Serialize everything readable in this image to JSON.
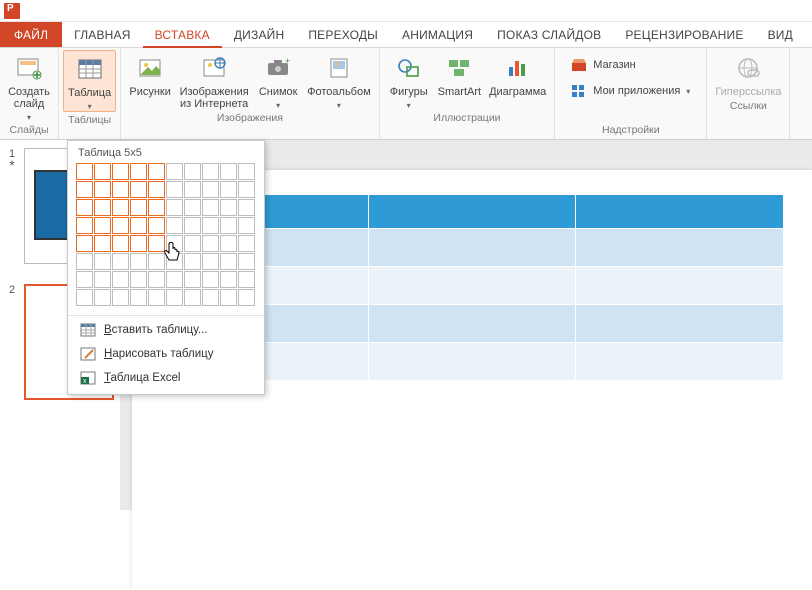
{
  "app": {
    "icon_letter": "P"
  },
  "tabs": {
    "file": "ФАЙЛ",
    "items": [
      "ГЛАВНАЯ",
      "ВСТАВКА",
      "ДИЗАЙН",
      "ПЕРЕХОДЫ",
      "АНИМАЦИЯ",
      "ПОКАЗ СЛАЙДОВ",
      "РЕЦЕНЗИРОВАНИЕ",
      "ВИД"
    ],
    "active_index": 1
  },
  "ribbon": {
    "groups": {
      "slides": {
        "label": "Слайды",
        "new_slide": "Создать\nслайд"
      },
      "tables": {
        "label": "Таблицы",
        "table_btn": "Таблица"
      },
      "images": {
        "label": "Изображения",
        "pictures": "Рисунки",
        "online": "Изображения\nиз Интернета",
        "screenshot": "Снимок",
        "album": "Фотоальбом"
      },
      "illus": {
        "label": "Иллюстрации",
        "shapes": "Фигуры",
        "smartart": "SmartArt",
        "chart": "Диаграмма"
      },
      "addins": {
        "label": "Надстройки",
        "store": "Магазин",
        "myapps": "Мои приложения"
      },
      "links": {
        "label": "Ссылки",
        "hyperlink": "Гиперссылка"
      }
    }
  },
  "dropdown": {
    "title": "Таблица 5x5",
    "highlight_rows": 5,
    "highlight_cols": 5,
    "insert": "Вставить таблицу...",
    "draw": "Нарисовать таблицу",
    "excel": "Таблица Excel"
  },
  "thumbs": {
    "items": [
      {
        "num": "1",
        "marker": "*",
        "selected": false,
        "has_blue": true
      },
      {
        "num": "2",
        "marker": "",
        "selected": true,
        "has_blue": false
      }
    ]
  },
  "preview_table": {
    "cols": 3,
    "rows": 5
  }
}
